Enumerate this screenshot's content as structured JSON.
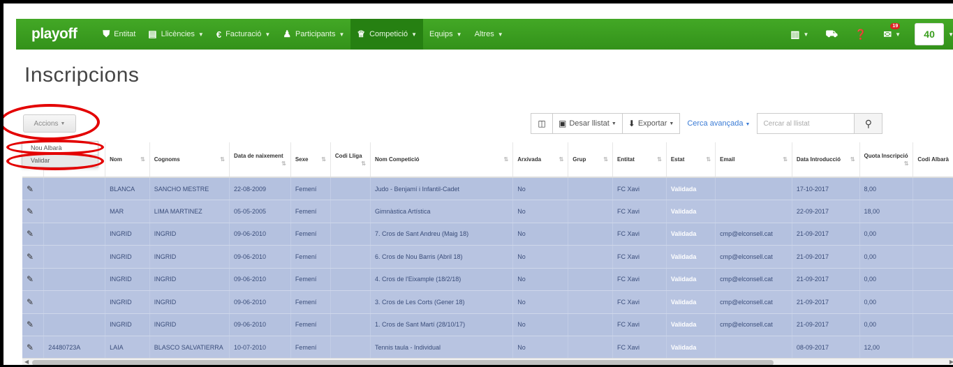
{
  "nav": {
    "brand": "playoff",
    "items": [
      {
        "icon": "shield-icon",
        "glyph": "⛊",
        "label": "Entitat",
        "caret": false
      },
      {
        "icon": "id-card-icon",
        "glyph": "▤",
        "label": "Llicències",
        "caret": true
      },
      {
        "icon": "euro-icon",
        "glyph": "€",
        "label": "Facturació",
        "caret": true
      },
      {
        "icon": "user-icon",
        "glyph": "👤",
        "label": "Participants",
        "caret": true
      },
      {
        "icon": "trophy-icon",
        "glyph": "🏆",
        "label": "Competició",
        "caret": true,
        "active": true
      },
      {
        "icon": "",
        "glyph": "",
        "label": "Equips",
        "caret": true
      },
      {
        "icon": "",
        "glyph": "",
        "label": "Altres",
        "caret": true
      }
    ],
    "notification_count": "19"
  },
  "page": {
    "title": "Inscripcions"
  },
  "toolbar": {
    "accions_label": "Accions",
    "accions_menu": [
      "Nou Albarà",
      "Validar"
    ],
    "save_list_label": "Desar llistat",
    "export_label": "Exportar",
    "advanced_search_label": "Cerca avançada",
    "search_placeholder": "Cercar al llistat"
  },
  "table": {
    "headers": [
      "",
      "",
      "Nom",
      "Cognoms",
      "Data de naixement",
      "Sexe",
      "Codi Lliga",
      "Nom Competició",
      "Arxivada",
      "Grup",
      "Entitat",
      "Estat",
      "Email",
      "Data Introducció",
      "Quota Inscripció",
      "Codi Albarà"
    ],
    "rows": [
      [
        "",
        "BLANCA",
        "SANCHO MESTRE",
        "22-08-2009",
        "Femení",
        "",
        "Judo - Benjamí i Infantil-Cadet",
        "No",
        "",
        "FC Xavi",
        "Validada",
        "",
        "17-10-2017",
        "8,00",
        ""
      ],
      [
        "",
        "MAR",
        "LIMA MARTINEZ",
        "05-05-2005",
        "Femení",
        "",
        "Gimnàstica Artística",
        "No",
        "",
        "FC Xavi",
        "Validada",
        "",
        "22-09-2017",
        "18,00",
        ""
      ],
      [
        "",
        "INGRID",
        "INGRID",
        "09-06-2010",
        "Femení",
        "",
        "7. Cros de Sant Andreu (Maig 18)",
        "No",
        "",
        "FC Xavi",
        "Validada",
        "cmp@elconsell.cat",
        "21-09-2017",
        "0,00",
        ""
      ],
      [
        "",
        "INGRID",
        "INGRID",
        "09-06-2010",
        "Femení",
        "",
        "6. Cros de Nou Barris (Abril 18)",
        "No",
        "",
        "FC Xavi",
        "Validada",
        "cmp@elconsell.cat",
        "21-09-2017",
        "0,00",
        ""
      ],
      [
        "",
        "INGRID",
        "INGRID",
        "09-06-2010",
        "Femení",
        "",
        "4. Cros de l'Eixample (18/2/18)",
        "No",
        "",
        "FC Xavi",
        "Validada",
        "cmp@elconsell.cat",
        "21-09-2017",
        "0,00",
        ""
      ],
      [
        "",
        "INGRID",
        "INGRID",
        "09-06-2010",
        "Femení",
        "",
        "3. Cros de Les Corts (Gener 18)",
        "No",
        "",
        "FC Xavi",
        "Validada",
        "cmp@elconsell.cat",
        "21-09-2017",
        "0,00",
        ""
      ],
      [
        "",
        "INGRID",
        "INGRID",
        "09-06-2010",
        "Femení",
        "",
        "1. Cros de Sant Martí (28/10/17)",
        "No",
        "",
        "FC Xavi",
        "Validada",
        "cmp@elconsell.cat",
        "21-09-2017",
        "0,00",
        ""
      ],
      [
        "24480723A",
        "LAIA",
        "BLASCO SALVATIERRA",
        "10-07-2010",
        "Femení",
        "",
        "Tennis taula - Individual",
        "No",
        "",
        "FC Xavi",
        "Validada",
        "",
        "08-09-2017",
        "12,00",
        ""
      ]
    ]
  }
}
